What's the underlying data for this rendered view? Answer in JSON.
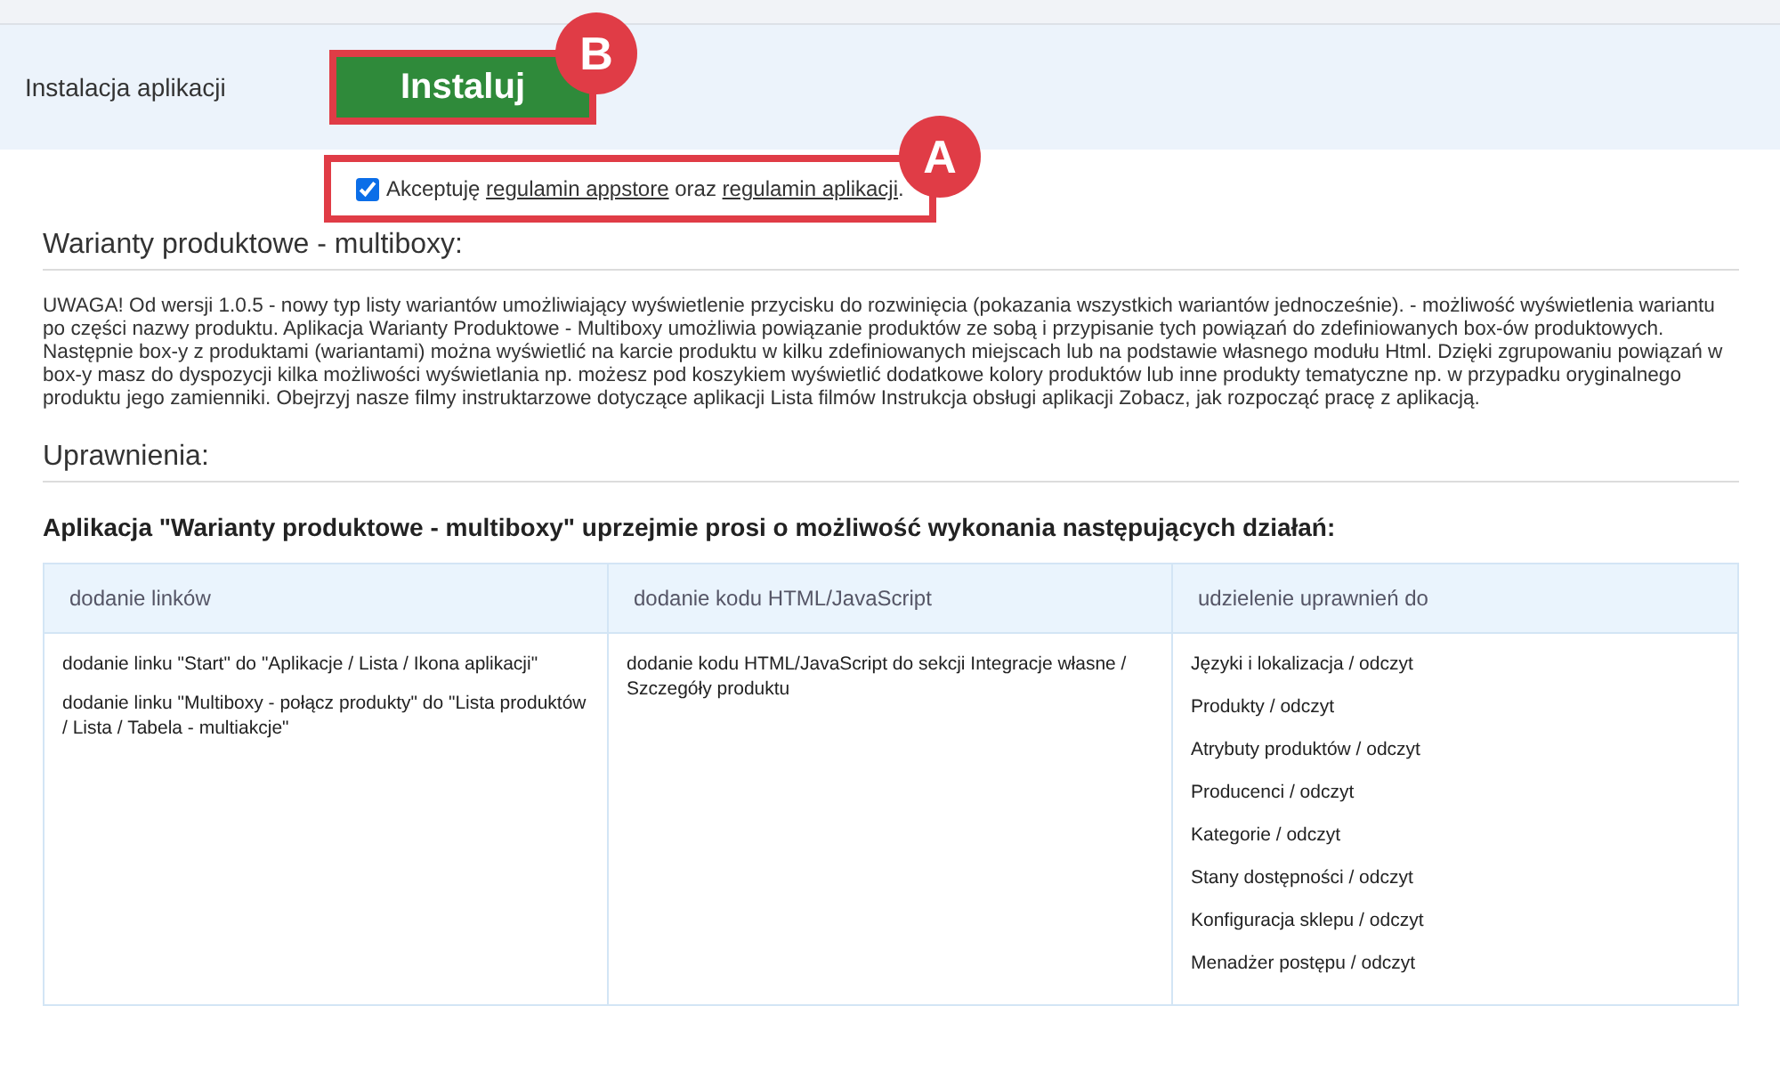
{
  "install": {
    "label": "Instalacja aplikacji",
    "button": "Instaluj",
    "callout": "B"
  },
  "terms": {
    "checked": true,
    "before": "Akceptuję",
    "link_1": "regulamin appstore",
    "middle": "oraz",
    "link_2": "regulamin aplikacji",
    "after": ".",
    "callout": "A"
  },
  "description": {
    "heading": "Warianty produktowe - multiboxy:",
    "text": "UWAGA! Od wersji 1.0.5 - nowy typ listy wariantów umożliwiający wyświetlenie przycisku do rozwinięcia (pokazania wszystkich wariantów jednocześnie). - możliwość wyświetlenia wariantu po części nazwy produktu. Aplikacja Warianty Produktowe - Multiboxy umożliwia powiązanie produktów ze sobą i przypisanie tych powiązań do zdefiniowanych box-ów produktowych. Następnie box-y z produktami (wariantami) można wyświetlić na karcie produktu w kilku zdefiniowanych miejscach lub na podstawie własnego modułu Html. Dzięki zgrupowaniu powiązań w box-y masz do dyspozycji kilka możliwości wyświetlania np. możesz pod koszykiem wyświetlić dodatkowe kolory produktów lub inne produkty tematyczne np. w przypadku oryginalnego produktu jego zamienniki. Obejrzyj nasze filmy instruktarzowe dotyczące aplikacji Lista filmów Instrukcja obsługi aplikacji Zobacz, jak rozpocząć pracę z aplikacją."
  },
  "permissions": {
    "heading": "Uprawnienia:",
    "intro": "Aplikacja \"Warianty produktowe - multiboxy\" uprzejmie prosi o możliwość wykonania następujących działań:",
    "table": {
      "columns": [
        "dodanie linków",
        "dodanie kodu HTML/JavaScript",
        "udzielenie uprawnień do"
      ],
      "cells": [
        [
          "dodanie linku \"Start\" do \"Aplikacje / Lista / Ikona aplikacji\"",
          "dodanie linku \"Multiboxy - połącz produkty\" do \"Lista produktów / Lista / Tabela - multiakcje\""
        ],
        [
          "dodanie kodu HTML/JavaScript do sekcji Integracje własne / Szczegóły produktu"
        ],
        [
          "Języki i lokalizacja / odczyt",
          "Produkty / odczyt",
          "Atrybuty produktów / odczyt",
          "Producenci / odczyt",
          "Kategorie / odczyt",
          "Stany dostępności / odczyt",
          "Konfiguracja sklepu / odczyt",
          "Menadżer postępu / odczyt"
        ]
      ]
    }
  }
}
